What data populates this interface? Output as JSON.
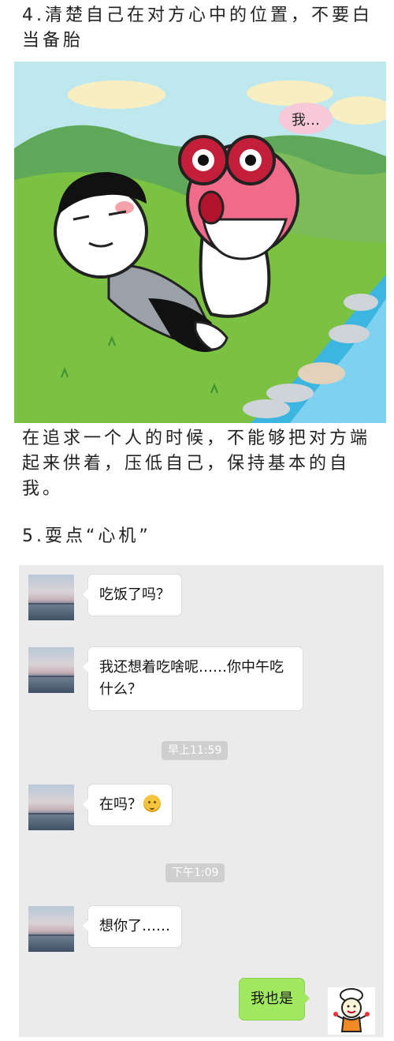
{
  "article": {
    "heading4": "4.清楚自己在对方心中的位置，不要白当备胎",
    "paragraph": "在追求一个人的时候，不能够把对方端起来供着，压低自己，保持基本的自我。",
    "heading5": "5.耍点“心机”"
  },
  "comic": {
    "speech_text": "我…"
  },
  "chat": {
    "messages": [
      {
        "text": "吃饭了吗？"
      },
      {
        "text": "我还想着吃啥呢……你中午吃什么？"
      },
      {
        "text": "在吗？"
      },
      {
        "text": "想你了……"
      },
      {
        "text": "我也是"
      }
    ],
    "timestamps": [
      "早上11:59",
      "下午1:09"
    ]
  },
  "icons": [
    "avatar",
    "smile-emoji-icon",
    "chef-sticker-avatar"
  ],
  "colors": {
    "chat_background": "#ebebeb",
    "bubble_incoming": "#ffffff",
    "bubble_outgoing": "#9fe85f",
    "timestamp_bg": "#cfcfcf"
  }
}
